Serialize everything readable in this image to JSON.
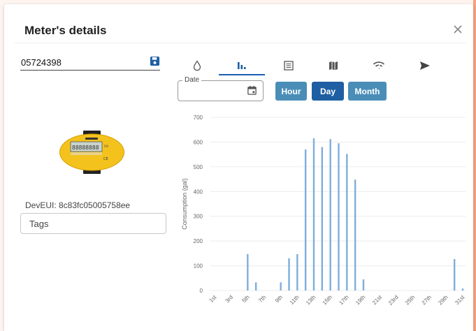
{
  "dialog": {
    "title": "Meter's details",
    "close_label": "×"
  },
  "meter": {
    "number": "05724398",
    "deveui": "DevEUI: 8c83fc05005758ee",
    "tags_placeholder": "Tags"
  },
  "tabs": [
    {
      "icon": "water-drop-icon",
      "active": false
    },
    {
      "icon": "bar-chart-icon",
      "active": true
    },
    {
      "icon": "list-icon",
      "active": false
    },
    {
      "icon": "map-icon",
      "active": false
    },
    {
      "icon": "wifi-signal-icon",
      "active": false
    },
    {
      "icon": "send-icon",
      "active": false
    }
  ],
  "date": {
    "label": "Date",
    "value": ""
  },
  "buttons": {
    "hour": "Hour",
    "day": "Day",
    "month": "Month",
    "selected": "Day"
  },
  "colors": {
    "primary": "#1e5fa3",
    "secondary": "#4a8eb8",
    "bars": "#7eaedb",
    "accent_edge": "#f6a27f"
  },
  "chart_data": {
    "type": "bar",
    "ylabel": "Consumption (gal)",
    "ylim": [
      0,
      700
    ],
    "yticks": [
      0,
      100,
      200,
      300,
      400,
      500,
      600,
      700
    ],
    "categories": [
      "1st",
      "2nd",
      "3rd",
      "4th",
      "5th",
      "6th",
      "7th",
      "8th",
      "9th",
      "10th",
      "11th",
      "12th",
      "13th",
      "14th",
      "15th",
      "16th",
      "17th",
      "18th",
      "19th",
      "20th",
      "21st",
      "22nd",
      "23rd",
      "24th",
      "25th",
      "26th",
      "27th",
      "28th",
      "29th",
      "30th",
      "31st"
    ],
    "tick_labels": [
      "1st",
      "3rd",
      "5th",
      "7th",
      "9th",
      "11th",
      "13th",
      "15th",
      "17th",
      "19th",
      "21st",
      "23rd",
      "25th",
      "27th",
      "29th",
      "31st"
    ],
    "values": [
      0,
      0,
      0,
      0,
      147,
      33,
      0,
      0,
      33,
      130,
      147,
      570,
      615,
      580,
      612,
      595,
      552,
      448,
      45,
      0,
      0,
      0,
      0,
      0,
      0,
      0,
      0,
      0,
      0,
      127,
      8
    ],
    "grid": true
  }
}
